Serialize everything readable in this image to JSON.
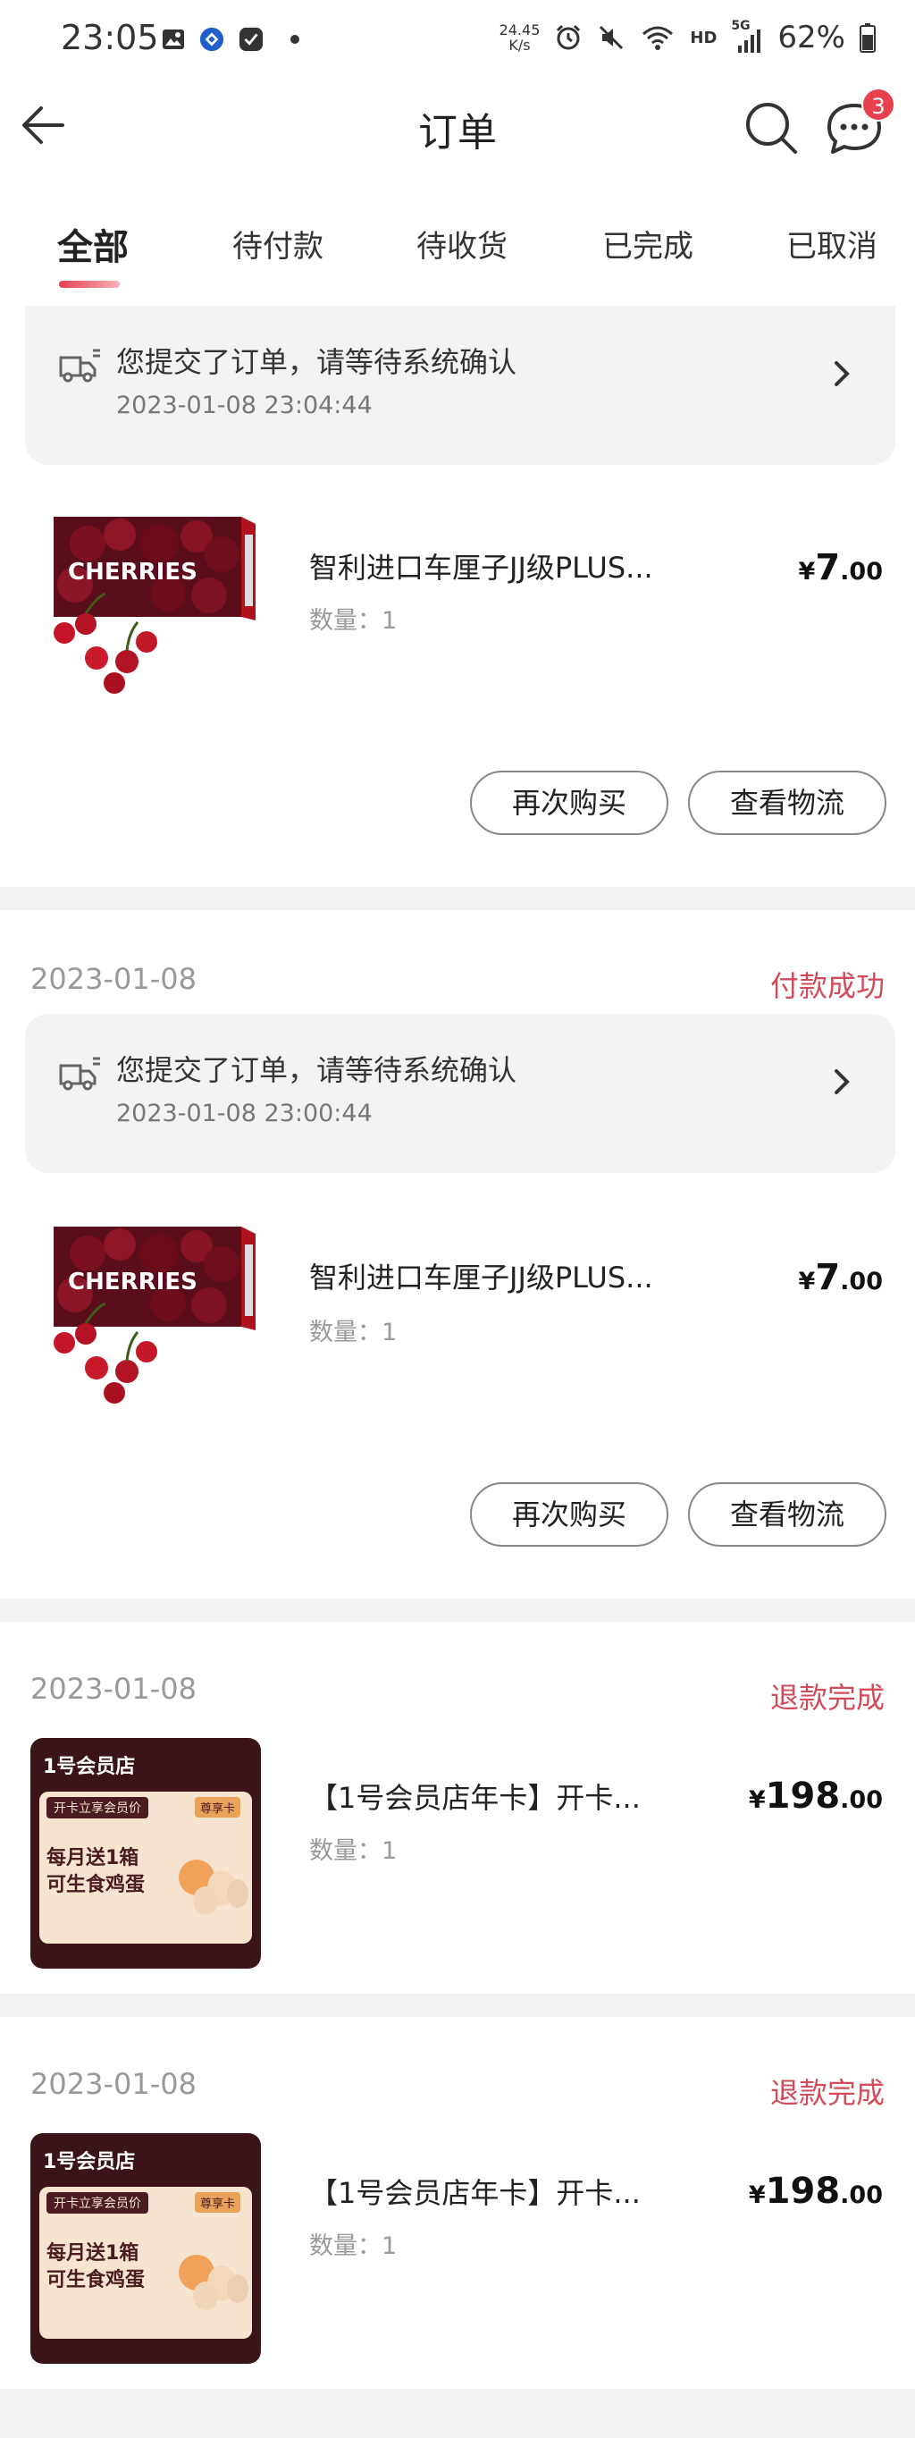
{
  "status_bar": {
    "time": "23:05",
    "net_speed_value": "24.45",
    "net_speed_unit": "K/s",
    "network": "HD",
    "cell": "5G",
    "battery": "62%",
    "icons": [
      "gallery-icon",
      "app-icon",
      "check-icon",
      "dot-icon",
      "alarm-icon",
      "mute-icon",
      "wifi-icon",
      "signal-icon",
      "battery-icon"
    ]
  },
  "nav": {
    "title": "订单",
    "message_badge": "3",
    "icons": [
      "back-arrow-icon",
      "search-icon",
      "message-icon"
    ]
  },
  "tabs": [
    {
      "label": "全部",
      "active": true
    },
    {
      "label": "待付款",
      "active": false
    },
    {
      "label": "待收货",
      "active": false
    },
    {
      "label": "已完成",
      "active": false
    },
    {
      "label": "已取消",
      "active": false
    }
  ],
  "orders": [
    {
      "notice": {
        "text": "您提交了订单，请等待系统确认",
        "time": "2023-01-08 23:04:44"
      },
      "product": {
        "name": "智利进口车厘子JJ级PLUS...",
        "qty": "数量：1",
        "price_symbol": "¥",
        "price_int": "7",
        "price_dec": ".00",
        "image_text": "CHERRIES"
      },
      "buttons": [
        "再次购买",
        "查看物流"
      ]
    },
    {
      "date": "2023-01-08",
      "status": "付款成功",
      "notice": {
        "text": "您提交了订单，请等待系统确认",
        "time": "2023-01-08 23:00:44"
      },
      "product": {
        "name": "智利进口车厘子JJ级PLUS...",
        "qty": "数量：1",
        "price_symbol": "¥",
        "price_int": "7",
        "price_dec": ".00",
        "image_text": "CHERRIES"
      },
      "buttons": [
        "再次购买",
        "查看物流"
      ]
    },
    {
      "date": "2023-01-08",
      "status": "退款完成",
      "product": {
        "name": "【1号会员店年卡】开卡...",
        "qty": "数量：1",
        "price_symbol": "¥",
        "price_int": "198",
        "price_dec": ".00",
        "image_text": {
          "brand": "1号会员店",
          "tag": "开卡立享会员价",
          "line1": "每月送1箱",
          "line2": "可生食鸡蛋",
          "badge": "尊享卡"
        }
      }
    },
    {
      "date": "2023-01-08",
      "status": "退款完成",
      "product": {
        "name": "【1号会员店年卡】开卡...",
        "qty": "数量：1",
        "price_symbol": "¥",
        "price_int": "198",
        "price_dec": ".00",
        "image_text": {
          "brand": "1号会员店",
          "tag": "开卡立享会员价",
          "line1": "每月送1箱",
          "line2": "可生食鸡蛋",
          "badge": "尊享卡"
        }
      }
    }
  ],
  "colors": {
    "accent": "#e8404f",
    "status_red": "#d14b5a",
    "separator": "#f2f2f4",
    "notice_bg": "#f3f3f5"
  }
}
